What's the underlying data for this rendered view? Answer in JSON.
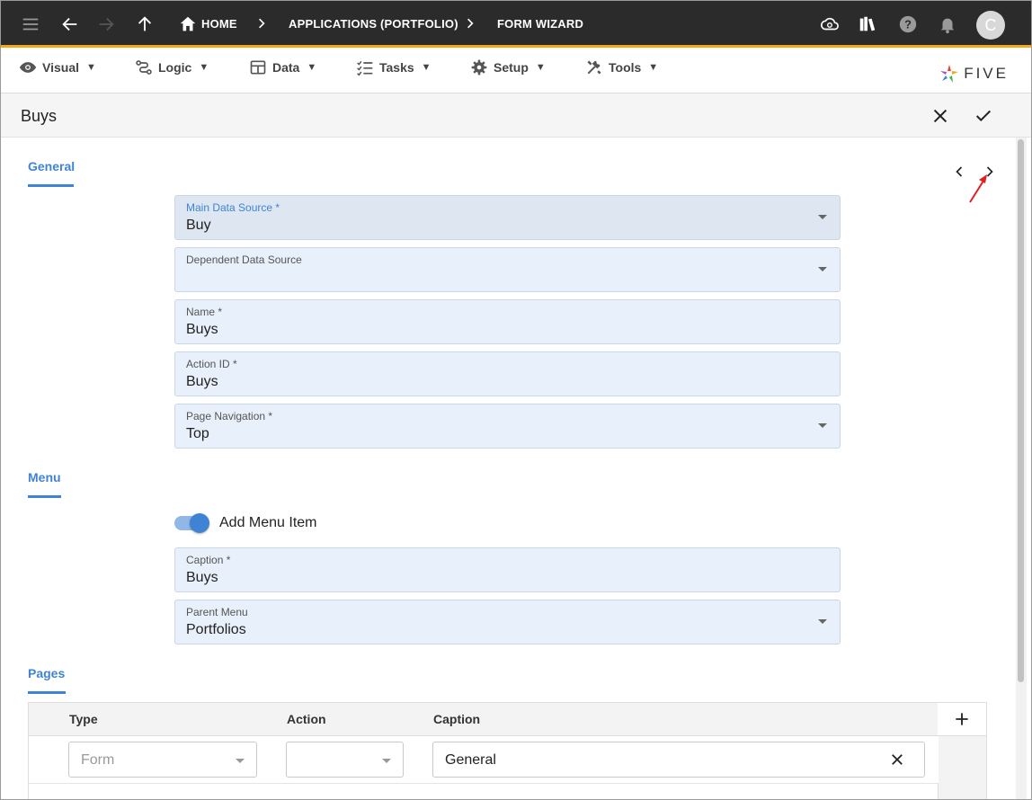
{
  "topbar": {
    "breadcrumbs": [
      {
        "label": "HOME"
      },
      {
        "label": "APPLICATIONS (PORTFOLIO)"
      },
      {
        "label": "FORM WIZARD"
      }
    ],
    "avatar_initial": "C"
  },
  "menubar": {
    "items": [
      {
        "label": "Visual",
        "icon": "eye-icon"
      },
      {
        "label": "Logic",
        "icon": "logic-icon"
      },
      {
        "label": "Data",
        "icon": "table-icon"
      },
      {
        "label": "Tasks",
        "icon": "tasks-icon"
      },
      {
        "label": "Setup",
        "icon": "gear-icon"
      },
      {
        "label": "Tools",
        "icon": "tools-icon"
      }
    ],
    "caret": "▼",
    "logo_text": "FIVE"
  },
  "form": {
    "title": "Buys",
    "sections": {
      "general": "General",
      "menu": "Menu",
      "pages": "Pages"
    },
    "fields": {
      "main_data_source": {
        "label": "Main Data Source *",
        "value": "Buy"
      },
      "dependent_data_source": {
        "label": "Dependent Data Source",
        "value": ""
      },
      "name": {
        "label": "Name *",
        "value": "Buys"
      },
      "action_id": {
        "label": "Action ID *",
        "value": "Buys"
      },
      "page_navigation": {
        "label": "Page Navigation *",
        "value": "Top"
      },
      "caption": {
        "label": "Caption *",
        "value": "Buys"
      },
      "parent_menu": {
        "label": "Parent Menu",
        "value": "Portfolios"
      }
    },
    "add_menu_item": {
      "label": "Add Menu Item",
      "checked": true
    },
    "pages_table": {
      "columns": [
        "Type",
        "Action",
        "Caption"
      ],
      "rows": [
        {
          "type_placeholder": "Form",
          "action": "",
          "caption": "General"
        }
      ]
    }
  },
  "colors": {
    "topbar_bg": "#2b2b2b",
    "accent_orange": "#f3a81b",
    "accent_blue": "#3f84d4",
    "field_bg": "#e8f0fb",
    "annotation_red": "#e02020"
  }
}
